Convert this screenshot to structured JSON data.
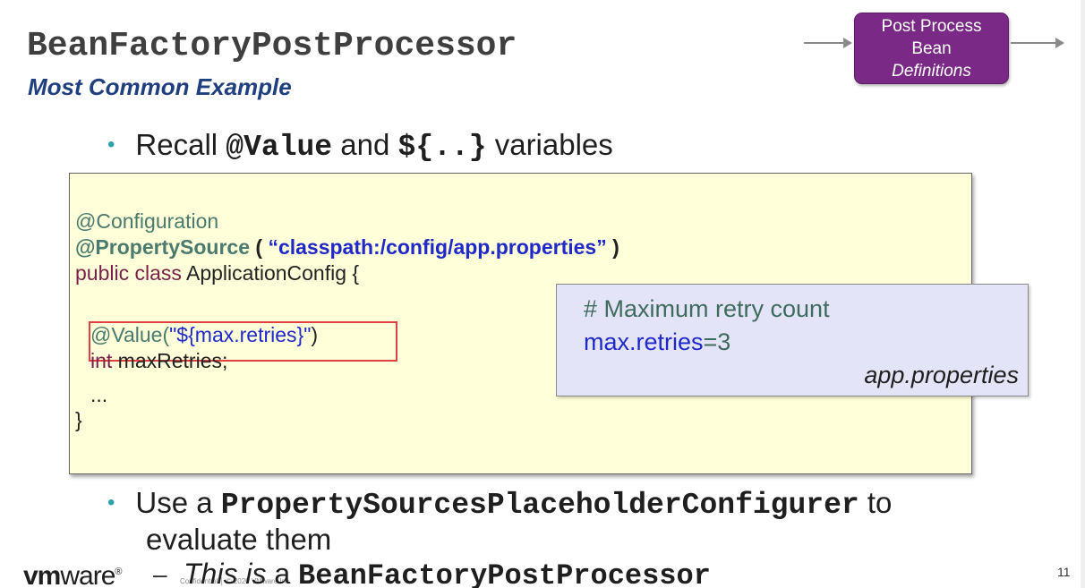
{
  "slide": {
    "title": "BeanFactoryPostProcessor",
    "subtitle": "Most Common Example",
    "process_box": {
      "line1": "Post Process",
      "line2": "Bean",
      "line3": "Definitions"
    },
    "bullet1": {
      "prefix": "Recall ",
      "code1": "@Value",
      "middle": " and ",
      "code2": "${..}",
      "suffix": " variables"
    },
    "code": {
      "line1": "@Configuration",
      "line2_annot": "@PropertySource",
      "line2_open": " ( ",
      "line2_str": "“classpath:/config/app.properties”",
      "line2_close": " )",
      "line3_kw": "public class",
      "line3_rest": " ApplicationConfig {",
      "line4_annot": "@Value(",
      "line4_str": "\"${max.retries}\"",
      "line4_close": ")",
      "line5_kw": "int",
      "line5_rest": " maxRetries;",
      "line6": "...",
      "line7": "}"
    },
    "properties": {
      "comment": "# Maximum retry count",
      "key": "max.retries",
      "value": "=3",
      "filename": "app.properties"
    },
    "bullet2": {
      "prefix": "Use a ",
      "code": "PropertySourcesPlaceholderConfigurer",
      "suffix": " to",
      "line2": "evaluate them"
    },
    "footer": {
      "logo_vm": "vm",
      "logo_ware": "ware",
      "logo_reg": "®",
      "dash": "–",
      "confidential": "Confidential │ © 2020 VMware Inc.",
      "note_prefix": "This is",
      "note_mid": " a ",
      "note_code": "BeanFactoryPostProcessor"
    },
    "page_number": "11"
  }
}
